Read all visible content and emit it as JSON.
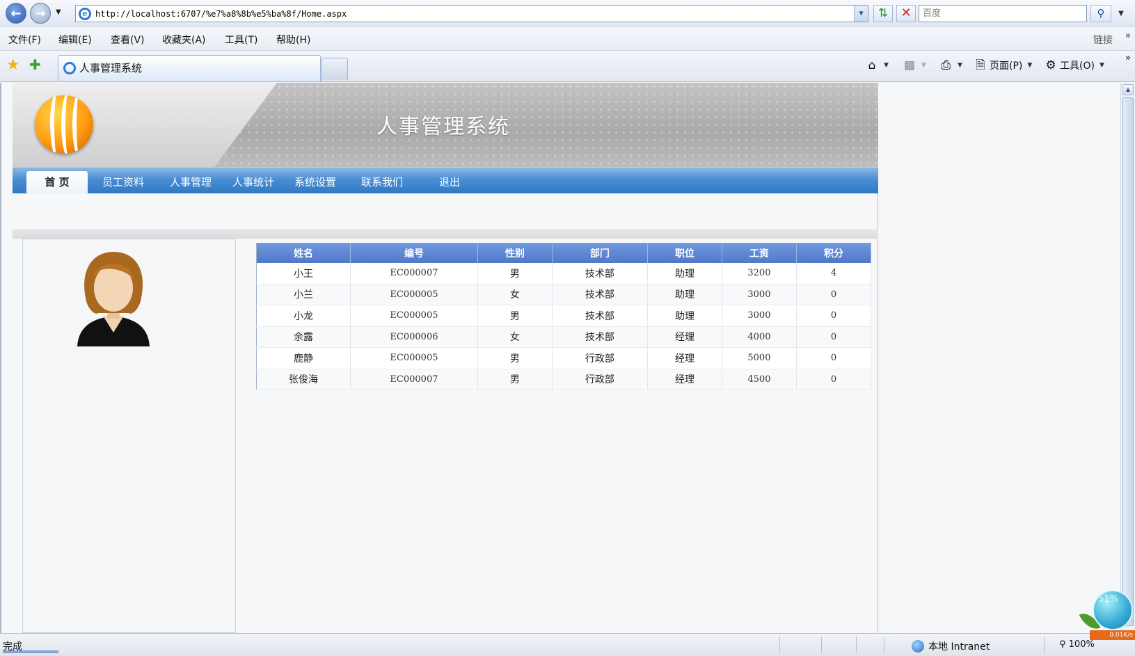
{
  "browser": {
    "url": "http://localhost:6707/%e7%a8%8b%e5%ba%8f/Home.aspx",
    "search_placeholder": "百度",
    "tab_title": "人事管理系统",
    "menu": [
      "文件(F)",
      "编辑(E)",
      "查看(V)",
      "收藏夹(A)",
      "工具(T)",
      "帮助(H)"
    ],
    "links_label": "链接",
    "commands": {
      "page": "页面(P)",
      "tools": "工具(O)"
    }
  },
  "site": {
    "title": "人事管理系统",
    "nav": [
      "首 页",
      "员工资料",
      "人事管理",
      "人事统计",
      "系统设置",
      "联系我们",
      "退出"
    ]
  },
  "table": {
    "headers": [
      "姓名",
      "编号",
      "性别",
      "部门",
      "职位",
      "工资",
      "积分"
    ],
    "rows": [
      [
        "小王",
        "EC000007",
        "男",
        "技术部",
        "助理",
        "3200",
        "4"
      ],
      [
        "小兰",
        "EC000005",
        "女",
        "技术部",
        "助理",
        "3000",
        "0"
      ],
      [
        "小龙",
        "EC000005",
        "男",
        "技术部",
        "助理",
        "3000",
        "0"
      ],
      [
        "余露",
        "EC000006",
        "女",
        "技术部",
        "经理",
        "4000",
        "0"
      ],
      [
        "鹿静",
        "EC000005",
        "男",
        "行政部",
        "经理",
        "5000",
        "0"
      ],
      [
        "张俊海",
        "EC000007",
        "男",
        "行政部",
        "经理",
        "4500",
        "0"
      ]
    ]
  },
  "status": {
    "text": "完成",
    "zone": "本地 Intranet",
    "zoom": "100%",
    "widget_percent": "51%",
    "widget_speed": "0.01K/s"
  }
}
